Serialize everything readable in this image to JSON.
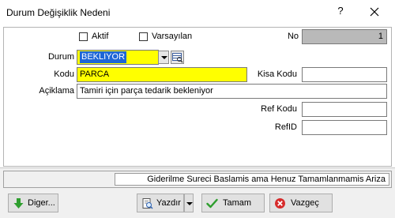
{
  "window": {
    "title": "Durum Değişiklik Nedeni",
    "help_glyph": "?"
  },
  "form": {
    "aktif_label": "Aktif",
    "varsayilan_label": "Varsayılan",
    "no_label": "No",
    "no_value": "1",
    "durum_label": "Durum",
    "durum_value": "BEKLIYOR",
    "kodu_label": "Kodu",
    "kodu_value": "PARCA",
    "kisa_kodu_label": "Kisa Kodu",
    "kisa_kodu_value": "",
    "aciklama_label": "Açiklama",
    "aciklama_value": "Tamiri için parça tedarik bekleniyor",
    "ref_kodu_label": "Ref Kodu",
    "ref_kodu_value": "",
    "refid_label": "RefID",
    "refid_value": ""
  },
  "status": {
    "message": "Giderilme Sureci Baslamis ama Henuz Tamamlanmamis Ariza"
  },
  "buttons": {
    "diger": "Diger...",
    "yazdir": "Yazdır",
    "tamam": "Tamam",
    "vazgec": "Vazgeç"
  },
  "colors": {
    "highlight_yellow": "#ffff00",
    "selection_blue": "#1e66d6",
    "readonly_grey": "#b9b9b9"
  }
}
